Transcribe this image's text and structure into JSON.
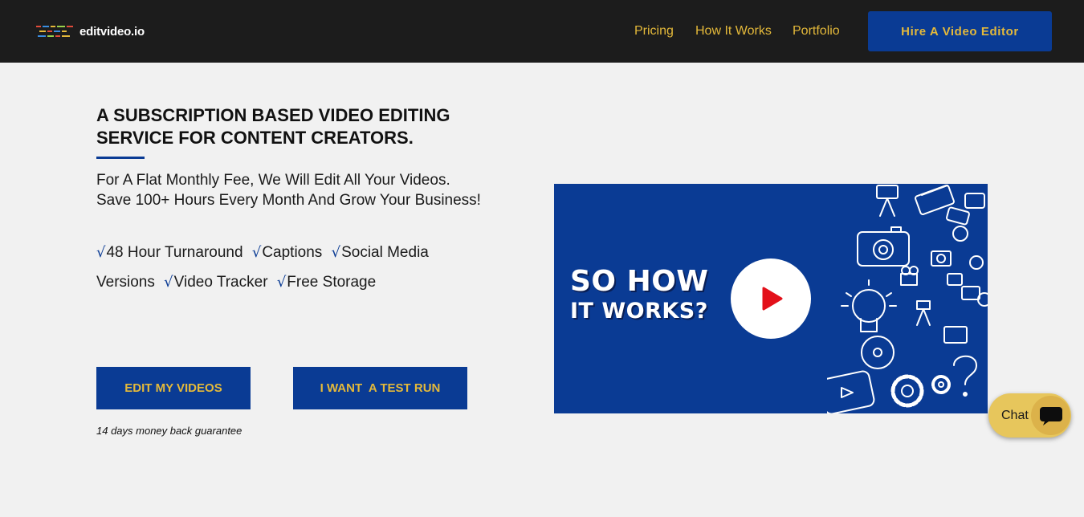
{
  "header": {
    "logo_text": "editvideo.io",
    "nav": [
      "Pricing",
      "How It Works",
      "Portfolio"
    ],
    "hire_button": "Hire A Video Editor"
  },
  "hero": {
    "headline": "A SUBSCRIPTION BASED VIDEO EDITING SERVICE FOR CONTENT CREATORS.",
    "subhead": "For A Flat Monthly Fee, We Will Edit All Your Videos. Save 100+ Hours Every Month And Grow Your Business!",
    "check_glyph": "√",
    "features": [
      "48 Hour Turnaround",
      "Captions",
      "Social Media Versions",
      "Video Tracker",
      "Free Storage"
    ],
    "cta_primary": "EDIT MY VIDEOS",
    "cta_secondary": "I WANT  A TEST RUN",
    "guarantee": "14 days money back guarantee"
  },
  "video": {
    "title_line1": "SO HOW",
    "title_line2": "IT WORKS?"
  },
  "chat": {
    "label": "Chat"
  },
  "colors": {
    "header_bg": "#1c1c1c",
    "accent_blue": "#0a3b94",
    "accent_gold": "#e4b93a",
    "page_bg": "#f1f1f1",
    "chat_bg": "#e7c65c",
    "play_red": "#e3101a"
  },
  "icons": [
    "logo-mark-icon",
    "check-icon",
    "play-icon",
    "camera-icon",
    "lightbulb-icon",
    "gear-icon",
    "chat-bubble-icon"
  ]
}
